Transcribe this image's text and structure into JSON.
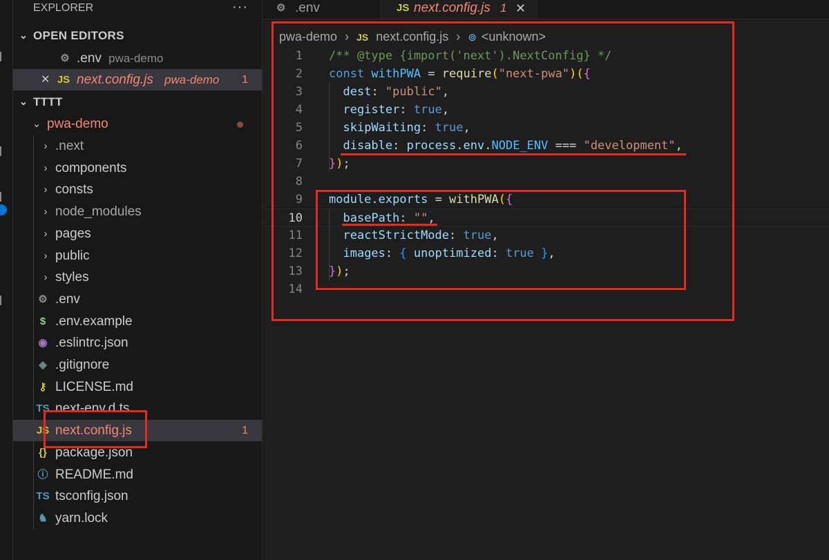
{
  "sidebar": {
    "title": "EXPLORER",
    "more": "···",
    "open_editors": {
      "label": "OPEN EDITORS",
      "items": [
        {
          "name": ".env",
          "folder": "pwa-demo"
        },
        {
          "close": "✕",
          "name": "next.config.js",
          "folder": "pwa-demo",
          "problems": "1"
        }
      ]
    },
    "workspace": {
      "label": "TTTT",
      "root": "pwa-demo",
      "folders": [
        ".next",
        "components",
        "consts",
        "node_modules",
        "pages",
        "public",
        "styles"
      ],
      "files": [
        {
          "name": ".env",
          "icon": "⚙",
          "color": "#8b8b8b"
        },
        {
          "name": ".env.example",
          "icon": "$",
          "color": "#89d185"
        },
        {
          "name": ".eslintrc.json",
          "icon": "◉",
          "color": "#a074c4"
        },
        {
          "name": ".gitignore",
          "icon": "◆",
          "color": "#6d8086"
        },
        {
          "name": "LICENSE.md",
          "icon": "⚷",
          "color": "#cbcb41"
        },
        {
          "name": "next-env.d.ts",
          "icon": "TS",
          "color": "#519aba"
        },
        {
          "name": "next.config.js",
          "icon": "JS",
          "color": "#cbcb41"
        },
        {
          "name": "package.json",
          "icon": "{}",
          "color": "#cbcb41"
        },
        {
          "name": "README.md",
          "icon": "ⓘ",
          "color": "#519aba"
        },
        {
          "name": "tsconfig.json",
          "icon": "TS",
          "color": "#519aba"
        },
        {
          "name": "yarn.lock",
          "icon": "♞",
          "color": "#519aba"
        }
      ],
      "selected_problems": "1"
    }
  },
  "tabs": [
    {
      "name": ".env",
      "icon": "⚙"
    },
    {
      "name": "next.config.js",
      "icon": "JS",
      "problems": "1",
      "close": "✕"
    }
  ],
  "breadcrumb": [
    "pwa-demo",
    "›",
    "JS",
    "next.config.js",
    "›",
    "⊚",
    "<unknown>"
  ],
  "editor": {
    "current_line": 10,
    "lines": [
      [
        [
          "t-cm",
          "/** @type {import('next').NextConfig} */"
        ]
      ],
      [
        [
          "t-kw",
          "const "
        ],
        [
          "t-const",
          "withPWA"
        ],
        [
          "t-p",
          " = "
        ],
        [
          "t-fn",
          "require"
        ],
        [
          "t-b1",
          "("
        ],
        [
          "t-str",
          "\"next-pwa\""
        ],
        [
          "t-b1",
          ")"
        ],
        [
          "t-b1",
          "("
        ],
        [
          "t-b2",
          "{"
        ]
      ],
      [
        [
          "t-p",
          "  "
        ],
        [
          "t-var",
          "dest"
        ],
        [
          "t-p",
          ": "
        ],
        [
          "t-str",
          "\"public\""
        ],
        [
          "t-p",
          ","
        ]
      ],
      [
        [
          "t-p",
          "  "
        ],
        [
          "t-var",
          "register"
        ],
        [
          "t-p",
          ": "
        ],
        [
          "t-kw",
          "true"
        ],
        [
          "t-p",
          ","
        ]
      ],
      [
        [
          "t-p",
          "  "
        ],
        [
          "t-var",
          "skipWaiting"
        ],
        [
          "t-p",
          ": "
        ],
        [
          "t-kw",
          "true"
        ],
        [
          "t-p",
          ","
        ]
      ],
      [
        [
          "t-p",
          "  "
        ],
        [
          "t-var",
          "disable"
        ],
        [
          "t-p",
          ": "
        ],
        [
          "t-var",
          "process"
        ],
        [
          "t-p",
          "."
        ],
        [
          "t-var",
          "env"
        ],
        [
          "t-p",
          "."
        ],
        [
          "t-const",
          "NODE_ENV"
        ],
        [
          "t-p",
          " === "
        ],
        [
          "t-str",
          "\"development\""
        ],
        [
          "t-p",
          ","
        ]
      ],
      [
        [
          "t-b2",
          "}"
        ],
        [
          "t-b1",
          ")"
        ],
        [
          "t-p",
          ";"
        ]
      ],
      [],
      [
        [
          "t-var",
          "module"
        ],
        [
          "t-p",
          "."
        ],
        [
          "t-var",
          "exports"
        ],
        [
          "t-p",
          " = "
        ],
        [
          "t-fn",
          "withPWA"
        ],
        [
          "t-b1",
          "("
        ],
        [
          "t-b2",
          "{"
        ]
      ],
      [
        [
          "t-p",
          "  "
        ],
        [
          "t-var",
          "basePath"
        ],
        [
          "t-p",
          ": "
        ],
        [
          "t-str",
          "\"\""
        ],
        [
          "t-p",
          ","
        ]
      ],
      [
        [
          "t-p",
          "  "
        ],
        [
          "t-var",
          "reactStrictMode"
        ],
        [
          "t-p",
          ": "
        ],
        [
          "t-kw",
          "true"
        ],
        [
          "t-p",
          ","
        ]
      ],
      [
        [
          "t-p",
          "  "
        ],
        [
          "t-var",
          "images"
        ],
        [
          "t-p",
          ": "
        ],
        [
          "t-b3",
          "{ "
        ],
        [
          "t-var",
          "unoptimized"
        ],
        [
          "t-p",
          ": "
        ],
        [
          "t-kw",
          "true"
        ],
        [
          "t-b3",
          " }"
        ],
        [
          "t-p",
          ","
        ]
      ],
      [
        [
          "t-b2",
          "}"
        ],
        [
          "t-b1",
          ")"
        ],
        [
          "t-p",
          ";"
        ]
      ],
      []
    ]
  },
  "colors": {
    "annotation": "#e8291c",
    "modified": "#f48771",
    "selection": "#37373d"
  }
}
